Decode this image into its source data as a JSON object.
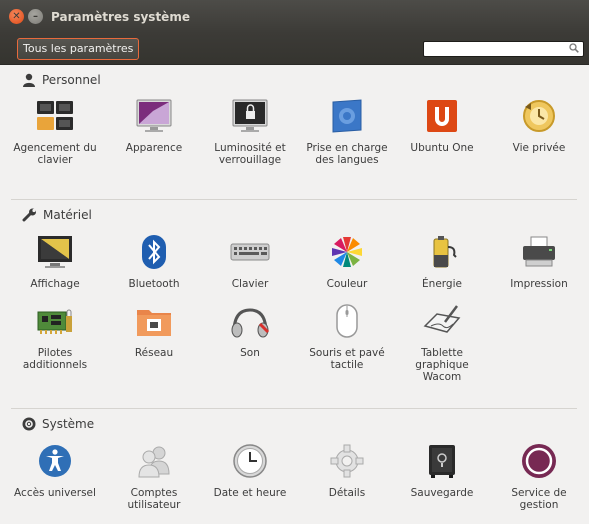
{
  "window": {
    "title": "Paramètres système"
  },
  "toolbar": {
    "all_settings_label": "Tous les paramètres",
    "search_placeholder": "",
    "search_value": ""
  },
  "sections": {
    "personnel": {
      "title": "Personnel",
      "items": [
        {
          "label": "Agencement du clavier",
          "icon": "keyboard-layout-icon"
        },
        {
          "label": "Apparence",
          "icon": "appearance-icon"
        },
        {
          "label": "Luminosité et verrouillage",
          "icon": "brightness-lock-icon"
        },
        {
          "label": "Prise en charge des langues",
          "icon": "language-support-icon"
        },
        {
          "label": "Ubuntu One",
          "icon": "ubuntu-one-icon"
        },
        {
          "label": "Vie privée",
          "icon": "privacy-icon"
        }
      ]
    },
    "materiel": {
      "title": "Matériel",
      "items": [
        {
          "label": "Affichage",
          "icon": "display-icon"
        },
        {
          "label": "Bluetooth",
          "icon": "bluetooth-icon"
        },
        {
          "label": "Clavier",
          "icon": "keyboard-icon"
        },
        {
          "label": "Couleur",
          "icon": "color-icon"
        },
        {
          "label": "Énergie",
          "icon": "power-icon"
        },
        {
          "label": "Impression",
          "icon": "printer-icon"
        },
        {
          "label": "Pilotes additionnels",
          "icon": "drivers-icon"
        },
        {
          "label": "Réseau",
          "icon": "network-icon"
        },
        {
          "label": "Son",
          "icon": "sound-icon"
        },
        {
          "label": "Souris et pavé tactile",
          "icon": "mouse-icon"
        },
        {
          "label": "Tablette graphique Wacom",
          "icon": "wacom-tablet-icon"
        }
      ]
    },
    "systeme": {
      "title": "Système",
      "items": [
        {
          "label": "Accès universel",
          "icon": "universal-access-icon"
        },
        {
          "label": "Comptes utilisateur",
          "icon": "user-accounts-icon"
        },
        {
          "label": "Date et heure",
          "icon": "clock-icon"
        },
        {
          "label": "Détails",
          "icon": "details-gear-icon"
        },
        {
          "label": "Sauvegarde",
          "icon": "backup-safe-icon"
        },
        {
          "label": "Service de gestion",
          "icon": "management-service-icon"
        }
      ]
    }
  },
  "colors": {
    "titlebar": "#3c3b37",
    "accent": "#e86a3c",
    "background": "#f2f1f0"
  }
}
